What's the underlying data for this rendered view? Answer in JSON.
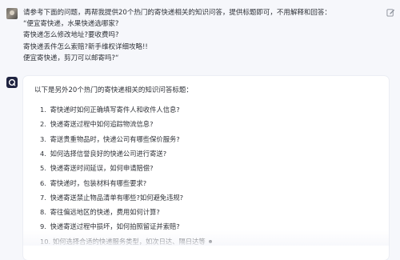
{
  "user": {
    "avatar_icon": "user-avatar-photo",
    "lines": [
      "请参考下面的问题，再帮我提供20个热门的寄快递相关的知识问答，提供标题即可，不用解释和回答：",
      "“便宜寄快递，水果快递选哪家?",
      "寄快递怎么修改地址?要收费吗?",
      "寄快递丢件怎么索赔?新手维权详细攻略!!",
      "便宜寄快递，剪刀可以邮寄吗?“"
    ],
    "edit_icon": "edit-icon"
  },
  "assistant": {
    "avatar_icon": "assistant-logo-icon",
    "intro": "以下是另外20个热门的寄快递相关的知识问答标题：",
    "items": [
      {
        "num": "1.",
        "text": "寄快递时如何正确填写寄件人和收件人信息?"
      },
      {
        "num": "2.",
        "text": "快递寄送过程中如何追踪物流信息?"
      },
      {
        "num": "3.",
        "text": "寄送贵重物品时，快递公司有哪些保价服务?"
      },
      {
        "num": "4.",
        "text": "如何选择信誉良好的快递公司进行寄送?"
      },
      {
        "num": "5.",
        "text": "快递寄送时间延误，如何申请赔偿?"
      },
      {
        "num": "6.",
        "text": "寄快递时，包装材料有哪些要求?"
      },
      {
        "num": "7.",
        "text": "快递寄送禁止物品清单有哪些?如何避免违规?"
      },
      {
        "num": "8.",
        "text": "寄往偏远地区的快递，费用如何计算?"
      },
      {
        "num": "9.",
        "text": "快递寄送过程中损坏，如何拍照留证并索赔?"
      },
      {
        "num": "10.",
        "text": "如何选择合适的快递服务类型，如次日达、隔日达等"
      }
    ]
  }
}
